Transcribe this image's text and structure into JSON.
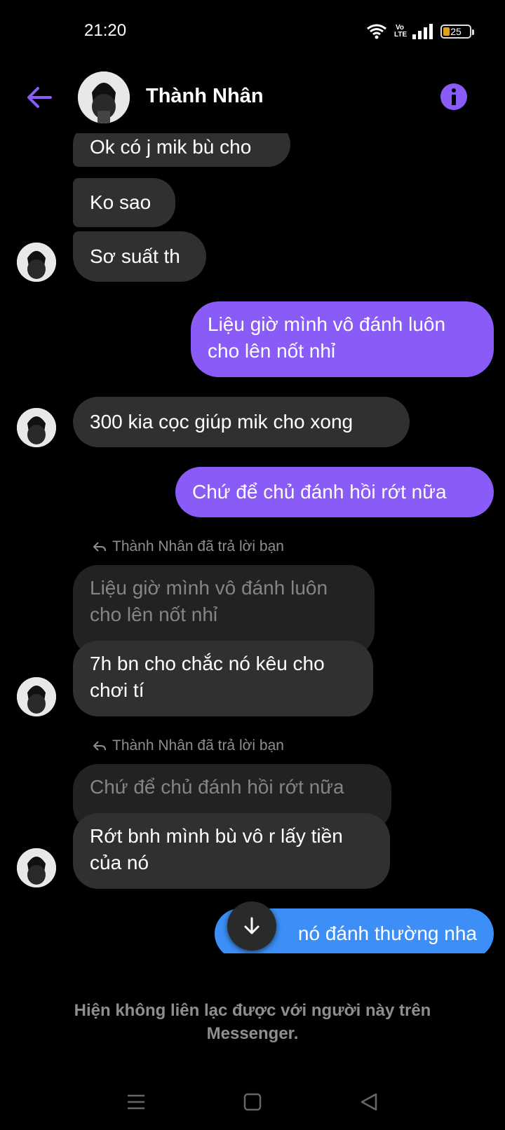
{
  "status_bar": {
    "time": "21:20",
    "volte_top": "Vo",
    "volte_bottom": "LTE",
    "battery": "25",
    "battery_level": 0.25
  },
  "header": {
    "contact_name": "Thành Nhân"
  },
  "messages": {
    "m1": "Ok có j mik bù cho",
    "m2": "Ko sao",
    "m3": "Sơ suất th",
    "m4": "Liệu giờ mình vô đánh luôn cho lên nốt nhỉ",
    "m5": "300 kia cọc giúp mik cho xong",
    "m6": "Chứ để chủ đánh hồi rớt nữa",
    "reply1_label": "Thành Nhân đã trả lời bạn",
    "reply1_quote": "Liệu giờ mình vô đánh luôn cho lên nốt nhỉ",
    "m7": "7h bn cho chắc nó kêu cho chơi tí",
    "reply2_label": "Thành Nhân đã trả lời bạn",
    "reply2_quote": "Chứ để chủ đánh hồi rớt nữa",
    "m8": "Rớt bnh mình bù vô r lấy tiền của nó",
    "m9": "nó đánh thường nha"
  },
  "notice": "Hiện không liên lạc được với người này trên Messenger.",
  "colors": {
    "accent": "#8a5cf7",
    "outgoing": "#8a5cf7",
    "outgoing_last": "#3d8ff7",
    "incoming": "#303030"
  }
}
